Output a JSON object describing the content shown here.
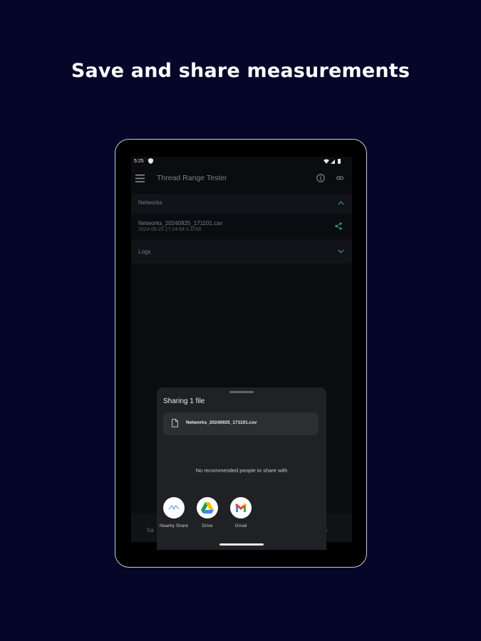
{
  "headline": "Save and share measurements",
  "status": {
    "time": "5:25"
  },
  "app": {
    "title": "Thread Range Tester",
    "sections": {
      "networks_label": "Networks",
      "logs_label": "Logs"
    },
    "file": {
      "name": "Networks_20240925_171101.csv",
      "date": "2024-09-25 17:24:54 0.3768"
    },
    "bottom_nav": {
      "left": "Sa",
      "right": "n"
    }
  },
  "share_sheet": {
    "title": "Sharing 1 file",
    "file_name": "Networks_20240925_171101.csv",
    "no_people_text": "No recommended people to share with",
    "targets": [
      {
        "label": "Nearby Share",
        "icon": "nearby-share-icon"
      },
      {
        "label": "Drive",
        "icon": "google-drive-icon"
      },
      {
        "label": "Gmail",
        "icon": "gmail-icon"
      }
    ]
  },
  "colors": {
    "background": "#050628",
    "accent": "#2f9c8a",
    "sheet": "#202124"
  }
}
